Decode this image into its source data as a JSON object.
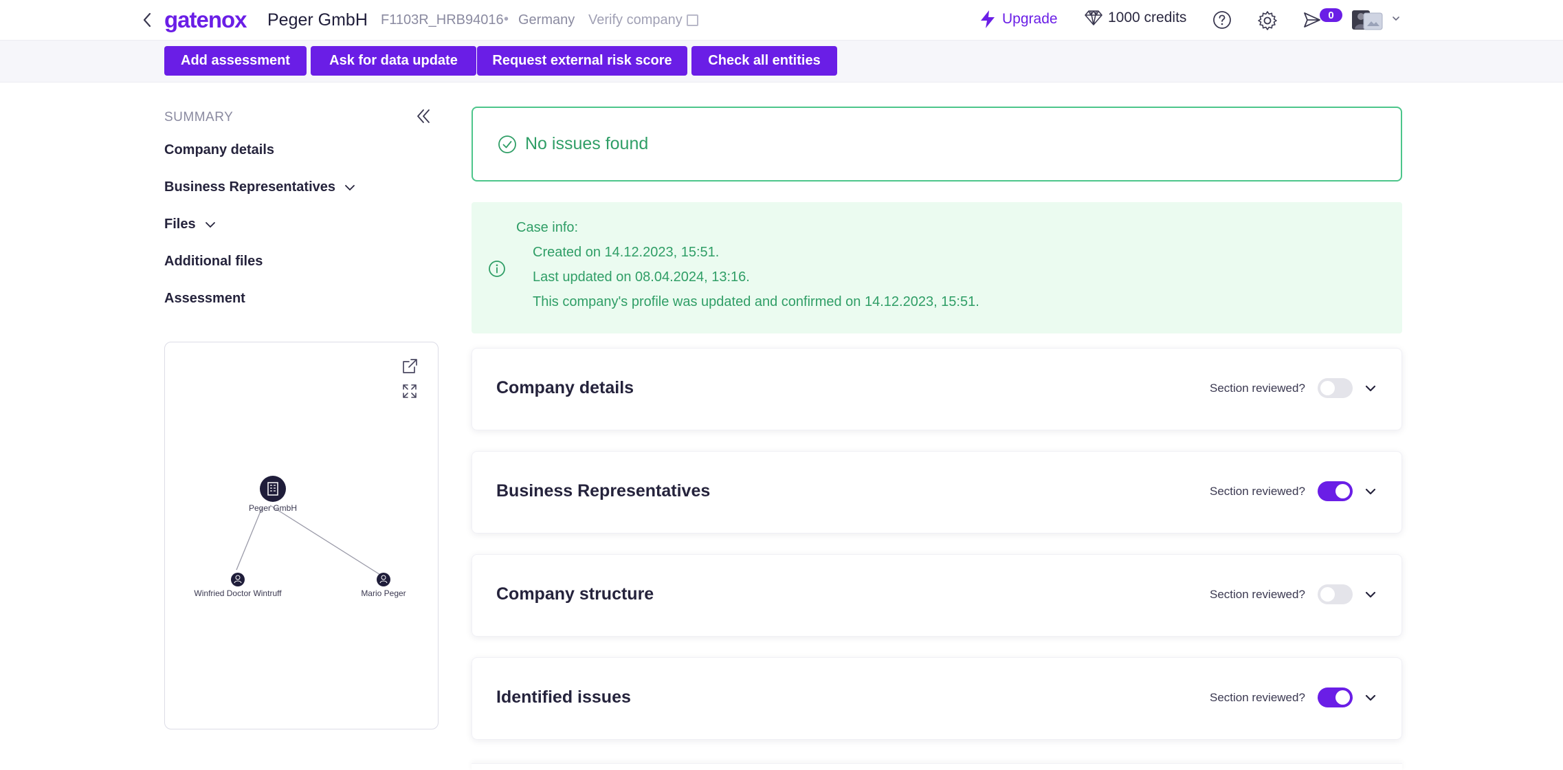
{
  "header": {
    "logo": "gatenox",
    "company_name": "Peger GmbH",
    "registration": "F1103R_HRB94016",
    "separator": "•",
    "country": "Germany",
    "verify_label": "Verify company",
    "upgrade_label": "Upgrade",
    "credits_label": "1000 credits",
    "notification_count": "0"
  },
  "actions": {
    "add_assessment": "Add assessment",
    "ask_update": "Ask for data update",
    "request_risk": "Request external risk score",
    "check_entities": "Check all entities"
  },
  "sidebar": {
    "summary_label": "SUMMARY",
    "items": [
      {
        "label": "Company details",
        "expandable": false
      },
      {
        "label": "Business Representatives",
        "expandable": true
      },
      {
        "label": "Files",
        "expandable": true
      },
      {
        "label": "Additional files",
        "expandable": false
      },
      {
        "label": "Assessment",
        "expandable": false
      }
    ]
  },
  "graph": {
    "nodes": [
      {
        "label": "Peger GmbH",
        "kind": "company"
      },
      {
        "label": "Winfried Doctor Wintruff",
        "kind": "person"
      },
      {
        "label": "Mario Peger",
        "kind": "person"
      }
    ]
  },
  "status": {
    "text": "No issues found"
  },
  "case_info": {
    "title": "Case info:",
    "created": "Created on 14.12.2023, 15:51.",
    "updated": "Last updated on 08.04.2024, 13:16.",
    "confirmed": "This company's profile was updated and confirmed on 14.12.2023, 15:51."
  },
  "sections": [
    {
      "title": "Company details",
      "reviewed_label": "Section reviewed?",
      "reviewed": false
    },
    {
      "title": "Business Representatives",
      "reviewed_label": "Section reviewed?",
      "reviewed": true
    },
    {
      "title": "Company structure",
      "reviewed_label": "Section reviewed?",
      "reviewed": false
    },
    {
      "title": "Identified issues",
      "reviewed_label": "Section reviewed?",
      "reviewed": true
    }
  ],
  "colors": {
    "brand": "#6a1ee6",
    "success": "#2f9e66",
    "success_bg": "#ebfbf0"
  }
}
